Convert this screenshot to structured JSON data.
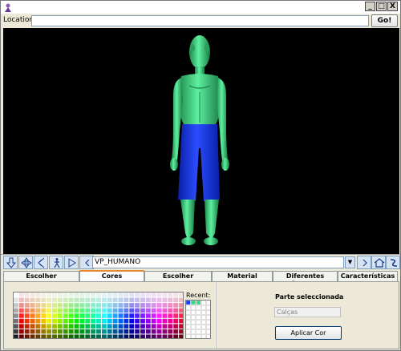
{
  "window": {
    "minimize": "_",
    "maximize": "□",
    "close": "X"
  },
  "location": {
    "label": "Location:",
    "value": "",
    "go_label": "Go!"
  },
  "navigation": {
    "viewpoint": "VP_HUMANO",
    "icons": [
      "down-arrow-icon",
      "move-icon",
      "back-icon",
      "walk-icon",
      "forward-icon",
      "prev-viewpoint-icon",
      "next-viewpoint-icon",
      "home-icon",
      "settings-icon"
    ]
  },
  "tabs": [
    {
      "label": "Escolher Personagem",
      "active": false
    },
    {
      "label": "Cores Personagem",
      "active": true
    },
    {
      "label": "Escolher Armadura",
      "active": false
    },
    {
      "label": "Material Armadura",
      "active": false
    },
    {
      "label": "Diferentes Ângulos",
      "active": false
    },
    {
      "label": "Características",
      "active": false
    }
  ],
  "colors_panel": {
    "recent_label": "Recent:",
    "part_label": "Parte seleccionada",
    "part_value": "Calças",
    "apply_label": "Aplicar Cor"
  },
  "figure": {
    "body_color": "#3ddc84",
    "pants_color": "#1a3cff"
  }
}
